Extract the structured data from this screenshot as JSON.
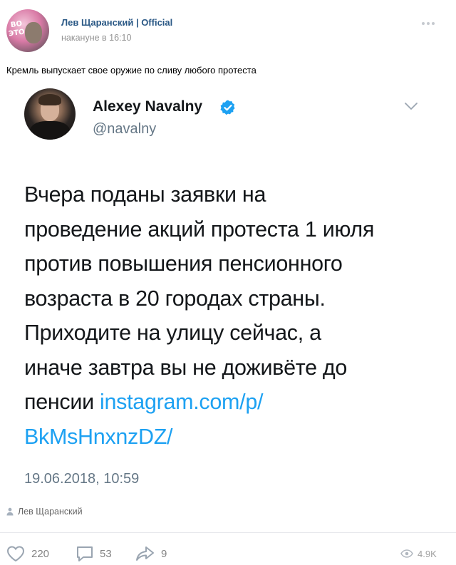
{
  "post": {
    "author_name": "Лев Щаранский | Official",
    "time": "накануне в 16:10",
    "text": "Кремль выпускает свое оружие по сливу любого протеста",
    "avatar_text_1": "ВО",
    "avatar_text_2": "ЭТО"
  },
  "tweet": {
    "name": "Alexey Navalny",
    "handle": "@navalny",
    "body_lines": [
      "Вчера поданы заявки на",
      "проведение акций протеста 1 июля",
      "против повышения пенсионного",
      "возраста в 20 городах страны.",
      "Приходите на улицу сейчас, а",
      "иначе завтра вы не доживёте до"
    ],
    "last_line_prefix": "пенсии ",
    "link_part_1": "instagram.com/p/",
    "link_part_2": "BkMsHnxnzDZ/",
    "date": "19.06.2018, 10:59",
    "verified_color": "#1da1f2"
  },
  "source": {
    "name": "Лев Щаранский"
  },
  "actions": {
    "likes": "220",
    "comments": "53",
    "shares": "9",
    "views": "4.9K"
  },
  "colors": {
    "link": "#1da1f2",
    "author": "#2a5885",
    "muted": "#828282"
  }
}
